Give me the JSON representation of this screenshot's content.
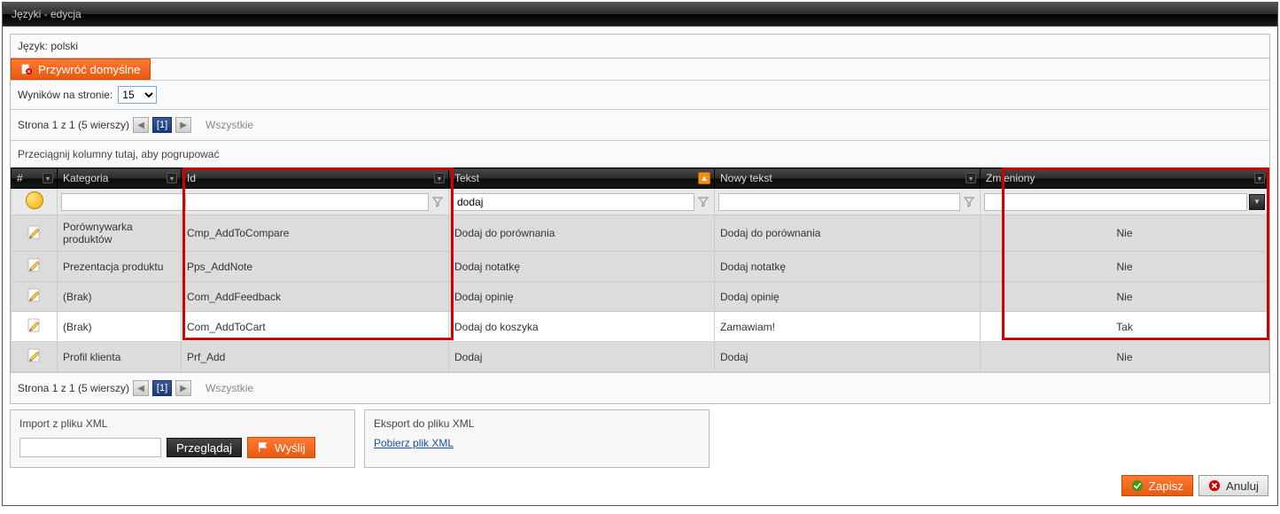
{
  "window": {
    "title": "Języki - edycja"
  },
  "language": {
    "label": "Język: polski"
  },
  "buttons": {
    "restore_defaults": "Przywróć domyślne",
    "browse": "Przeglądaj",
    "send": "Wyślij",
    "save": "Zapisz",
    "cancel": "Anuluj"
  },
  "results_per_page": {
    "label": "Wyników na stronie:",
    "value": "15"
  },
  "pager": {
    "text": "Strona 1 z 1 (5 wierszy)",
    "current": "[1]",
    "all": "Wszystkie"
  },
  "grouping": {
    "hint": "Przeciągnij kolumny tutaj, aby pogrupować"
  },
  "columns": {
    "hash": "#",
    "kategoria": "Kategoria",
    "id": "Id",
    "tekst": "Tekst",
    "nowy_tekst": "Nowy tekst",
    "zmieniony": "Zmieniony"
  },
  "filters": {
    "kategoria": "",
    "id": "",
    "tekst": "dodaj",
    "nowy_tekst": "",
    "zmieniony": ""
  },
  "rows": [
    {
      "kategoria": "Porównywarka produktów",
      "id": "Cmp_AddToCompare",
      "tekst": "Dodaj do porównania",
      "nowy": "Dodaj do porównania",
      "zmieniony": "Nie",
      "odd": true
    },
    {
      "kategoria": "Prezentacja produktu",
      "id": "Pps_AddNote",
      "tekst": "Dodaj notatkę",
      "nowy": "Dodaj notatkę",
      "zmieniony": "Nie",
      "odd": true
    },
    {
      "kategoria": "(Brak)",
      "id": "Com_AddFeedback",
      "tekst": "Dodaj opinię",
      "nowy": "Dodaj opinię",
      "zmieniony": "Nie",
      "odd": true
    },
    {
      "kategoria": "(Brak)",
      "id": "Com_AddToCart",
      "tekst": "Dodaj do koszyka",
      "nowy": "Zamawiam!",
      "zmieniony": "Tak",
      "odd": false
    },
    {
      "kategoria": "Profil klienta",
      "id": "Prf_Add",
      "tekst": "Dodaj",
      "nowy": "Dodaj",
      "zmieniony": "Nie",
      "odd": true
    }
  ],
  "import_box": {
    "title": "Import z pliku XML"
  },
  "export_box": {
    "title": "Eksport do pliku XML",
    "link": "Pobierz plik XML"
  }
}
